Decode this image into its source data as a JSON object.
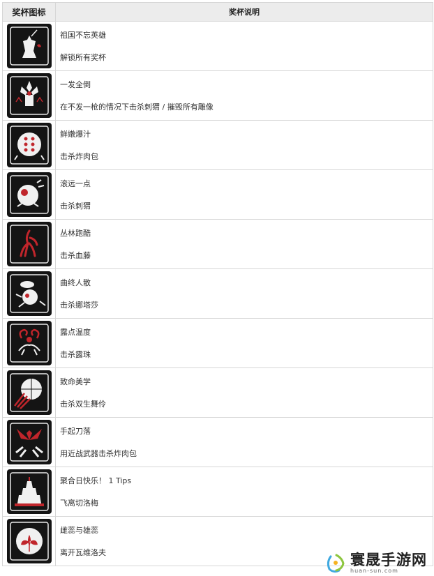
{
  "header": {
    "col_icon": "奖杯图标",
    "col_desc": "奖杯说明"
  },
  "rows": [
    {
      "title": "祖国不忘英雄",
      "desc": "解锁所有奖杯",
      "icon": "statue-icon"
    },
    {
      "title": "一发全倒",
      "desc": "在不发一枪的情况下击杀刺猬 / 摧毁所有雕像",
      "icon": "flower-mech-icon"
    },
    {
      "title": "鲜嫩爆汁",
      "desc": "击杀炸肉包",
      "icon": "dotted-robot-icon"
    },
    {
      "title": "滚远一点",
      "desc": "击杀刺猬",
      "icon": "rolling-robot-icon"
    },
    {
      "title": "丛林跑酷",
      "desc": "击杀血藤",
      "icon": "vine-creature-icon"
    },
    {
      "title": "曲终人散",
      "desc": "击杀娜塔莎",
      "icon": "ballerina-robot-icon"
    },
    {
      "title": "露点温度",
      "desc": "击杀露珠",
      "icon": "tentacle-creature-icon"
    },
    {
      "title": "致命美学",
      "desc": "击杀双生舞伶",
      "icon": "claw-sphere-icon"
    },
    {
      "title": "手起刀落",
      "desc": "用近战武器击杀炸肉包",
      "icon": "winged-blades-icon"
    },
    {
      "title": "聚合日快乐！ 1 Tips",
      "desc": "飞离切洛梅",
      "icon": "tower-icon"
    },
    {
      "title": "雌蕊与雄蕊",
      "desc": "离开瓦维洛夫",
      "icon": "flower-icon"
    }
  ],
  "watermark": {
    "main": "寰晟手游网",
    "sub": "huan-sun.com"
  },
  "colors": {
    "badge": "#141414",
    "accent": "#c0252b",
    "border": "#d6d6d6",
    "header_bg": "#ececec"
  }
}
